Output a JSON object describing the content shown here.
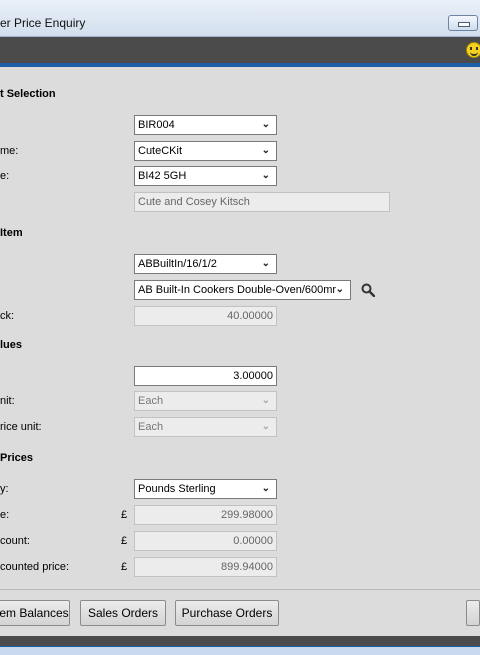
{
  "window": {
    "title": "er Price Enquiry"
  },
  "colors": {
    "accent": "#1d5fa8",
    "toolbar": "#4b4b4b",
    "background": "#dcdcdc"
  },
  "icons": {
    "toolbar_right": "smiley-icon",
    "search": "search-icon",
    "dropdown": "chevron-down-icon"
  },
  "customer_selection": {
    "heading": "t Selection",
    "account": {
      "label": "",
      "value": "BIR004"
    },
    "name": {
      "label": "me:",
      "value": "CuteCKit"
    },
    "postcode": {
      "label": "e:",
      "value": "BI42 5GH"
    },
    "company": {
      "value": "Cute and Cosey Kitsch"
    }
  },
  "stock_item": {
    "heading": "Item",
    "code": {
      "value": "ABBuiltIn/16/1/2"
    },
    "description": {
      "value": "AB Built-In Cookers Double-Oven/600mr"
    },
    "in_stock": {
      "label": "ck:",
      "value": "40.00000"
    }
  },
  "values": {
    "heading": "lues",
    "quantity": {
      "label": "",
      "value": "3.00000"
    },
    "unit": {
      "label": "nit:",
      "value": "Each"
    },
    "price_unit": {
      "label": "rice unit:",
      "value": "Each"
    }
  },
  "prices": {
    "heading": "Prices",
    "currency": {
      "label": "y:",
      "value": "Pounds Sterling"
    },
    "unit_price": {
      "label": "e:",
      "symbol": "£",
      "value": "299.98000"
    },
    "discount": {
      "label": "count:",
      "symbol": "£",
      "value": "0.00000"
    },
    "discounted_price": {
      "label": "counted price:",
      "symbol": "£",
      "value": "899.94000"
    }
  },
  "buttons": {
    "item_balances": "em Balances",
    "sales_orders": "Sales Orders",
    "purchase_orders": "Purchase Orders"
  }
}
